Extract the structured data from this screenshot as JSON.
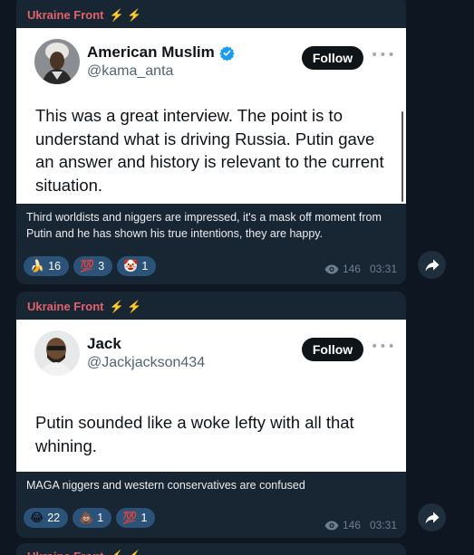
{
  "messages": [
    {
      "channel": "Ukraine Front",
      "channel_emoji": "⚡ ⚡",
      "tweet": {
        "name": "American Muslim",
        "handle": "@kama_anta",
        "follow_label": "Follow",
        "verified": true,
        "text": "This was a great interview.  The point is to understand what is driving Russia.  Putin gave an answer and history is relevant to the current situation."
      },
      "caption": "Third worldists and niggers are impressed, it's a mask off moment from Putin and he has shown his true intentions, they are happy.",
      "reactions": [
        {
          "emoji": "🍌",
          "count": "16"
        },
        {
          "emoji": "💯",
          "count": "3"
        },
        {
          "emoji": "🤡",
          "count": "1"
        }
      ],
      "views": "146",
      "time": "03:31"
    },
    {
      "channel": "Ukraine Front",
      "channel_emoji": "⚡ ⚡",
      "tweet": {
        "name": "Jack",
        "handle": "@Jackjackson434",
        "follow_label": "Follow",
        "verified": false,
        "text": "Putin sounded like a woke lefty with all that whining."
      },
      "caption": "MAGA niggers and western conservatives are confused",
      "reactions": [
        {
          "emoji": "😂",
          "count": "22"
        },
        {
          "emoji": "💩",
          "count": "1"
        },
        {
          "emoji": "💯",
          "count": "1"
        }
      ],
      "views": "146",
      "time": "03:31"
    }
  ],
  "colors": {
    "background": "#0e1621",
    "bubble": "#182533",
    "channel_name": "#e0636b",
    "reaction_pill": "#2b5278",
    "verified": "#1d9bf0"
  }
}
